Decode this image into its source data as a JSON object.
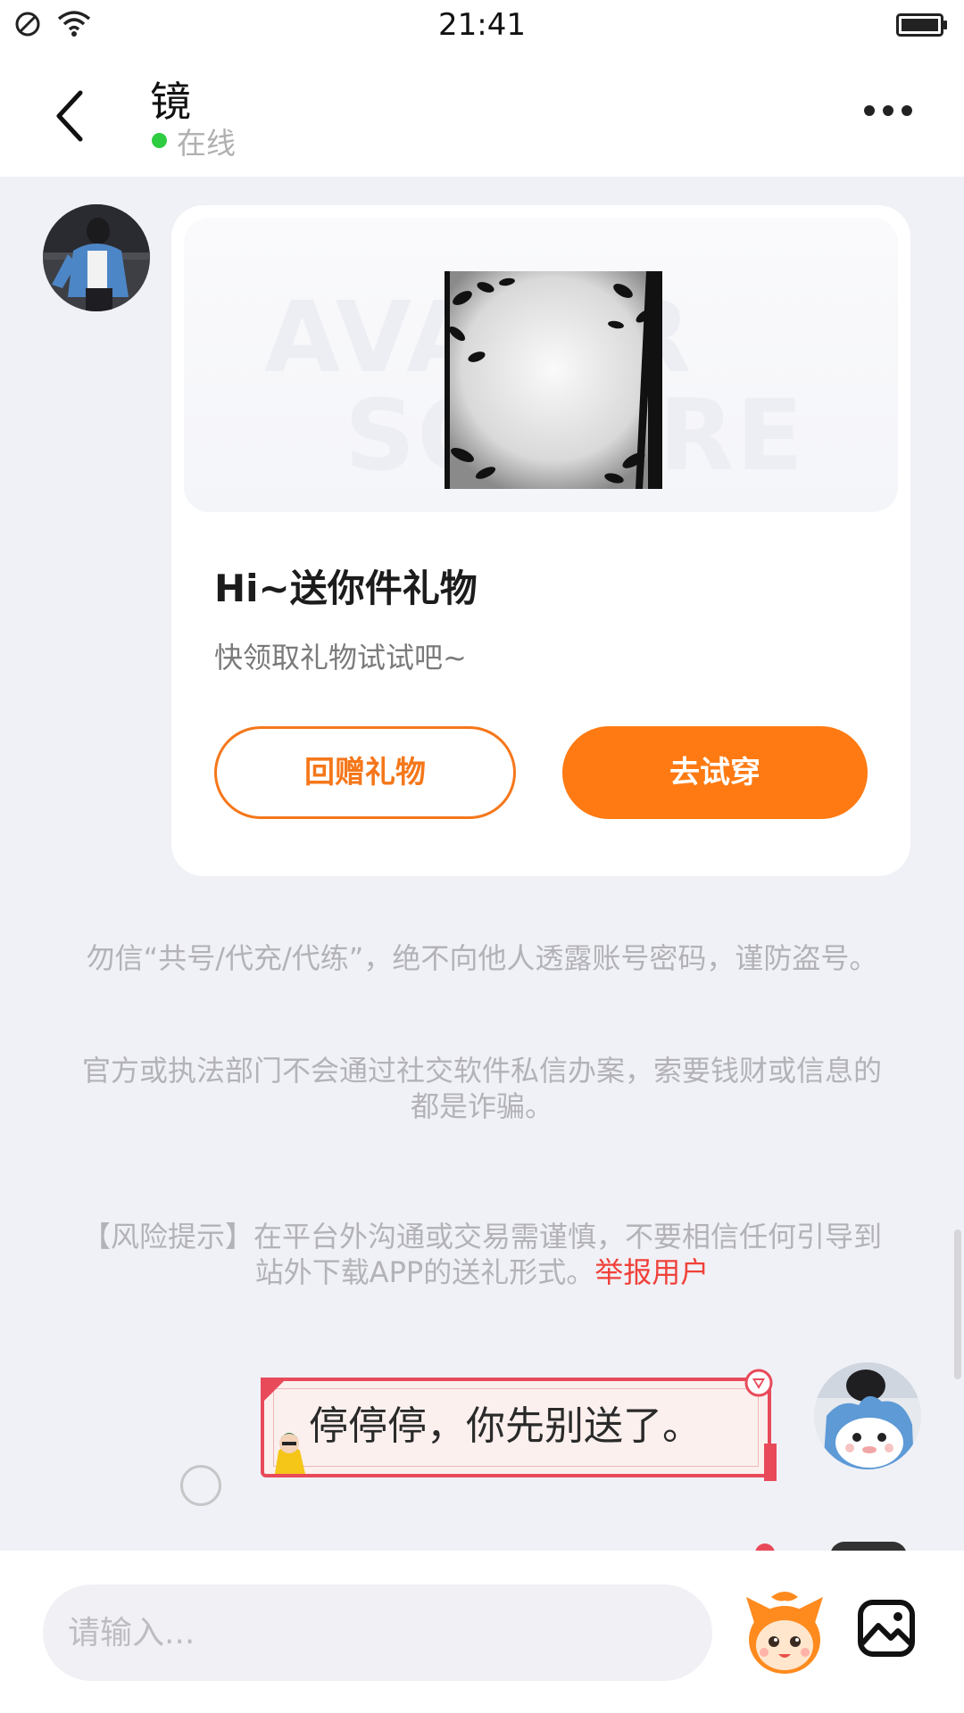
{
  "status_bar": {
    "time": "21:41",
    "icons": [
      "do-not-disturb-icon",
      "wifi-icon",
      "battery-icon"
    ]
  },
  "header": {
    "contact_name": "镜",
    "status": "在线",
    "status_color": "#2ecc40",
    "back_icon": "chevron-left-icon",
    "more_icon": "more-dots-icon"
  },
  "gift_card": {
    "banner_watermark": [
      "AVATAR",
      "SQUARE"
    ],
    "title": "Hi~送你件礼物",
    "subtitle": "快领取礼物试试吧~",
    "return_gift_label": "回赠礼物",
    "try_on_label": "去试穿",
    "accent_color": "#ff7a12"
  },
  "notices": {
    "line1": "勿信“共号/代充/代练”，绝不向他人透露账号密码，谨防盗号。",
    "line2": "官方或执法部门不会通过社交软件私信办案，索要钱财或信息的都是诈骗。",
    "risk_text": "【风险提示】在平台外沟通或交易需谨慎，不要相信任何引导到站外下载APP的送礼形式。",
    "report_label": "举报用户",
    "report_color": "#f0413a"
  },
  "messages": [
    {
      "sender": "me",
      "text": "停停停，你先别送了。"
    }
  ],
  "input": {
    "placeholder": "请输入..."
  },
  "toolbar_icons": [
    "sticker-icon",
    "image-icon"
  ]
}
